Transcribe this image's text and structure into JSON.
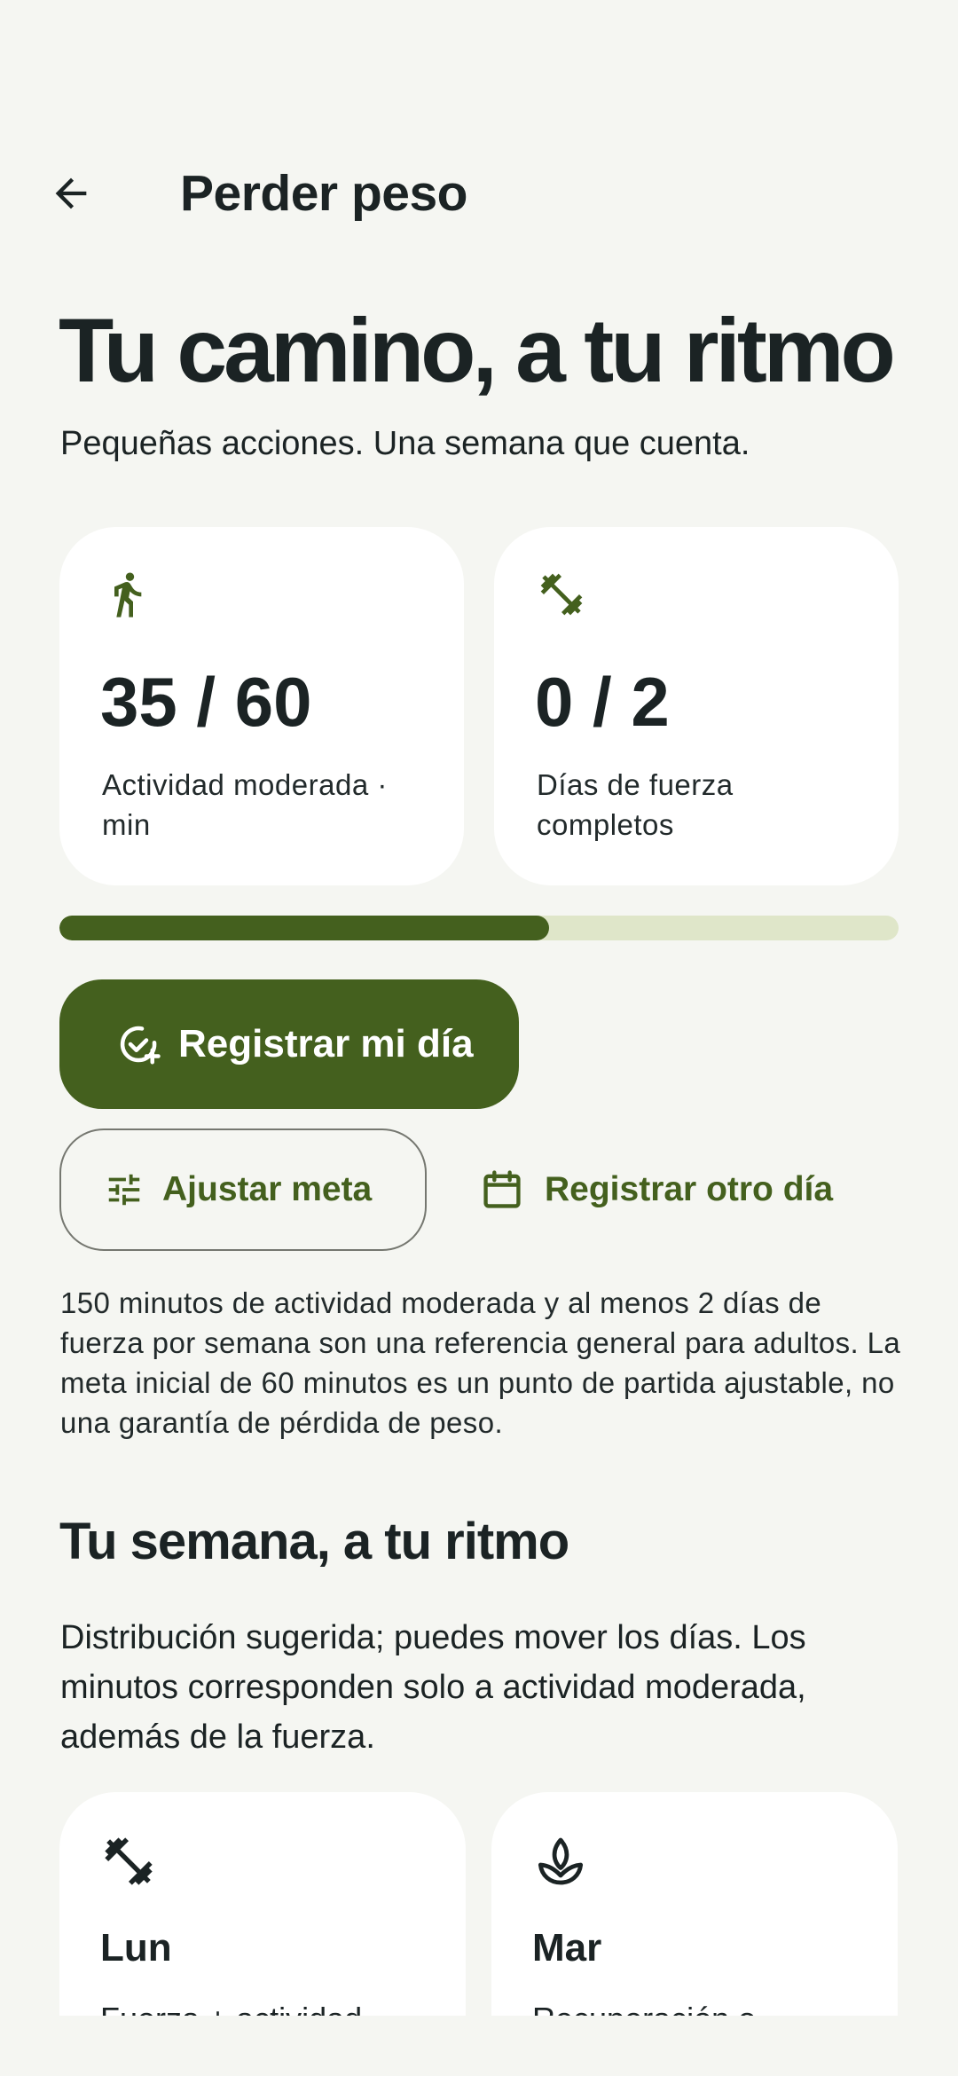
{
  "header": {
    "title": "Perder peso"
  },
  "hero": {
    "title": "Tu camino, a tu ritmo",
    "subtitle": "Pequeñas acciones. Una semana que cuenta."
  },
  "stats": [
    {
      "icon": "walking-person-icon",
      "value": "35 / 60",
      "label": "Actividad moderada · min"
    },
    {
      "icon": "dumbbell-icon",
      "value": "0 / 2",
      "label": "Días de fuerza completos"
    }
  ],
  "progress": {
    "fraction": 0.583
  },
  "actions": {
    "primary_label": "Registrar mi día",
    "adjust_label": "Ajustar meta",
    "other_day_label": "Registrar otro día"
  },
  "note": "150 minutos de actividad moderada y al menos 2 días de fuerza por semana son una referencia general para adultos. La meta inicial de 60 minutos es un punto de partida ajustable, no una garantía de pérdida de peso.",
  "week": {
    "title": "Tu semana, a tu ritmo",
    "description": "Distribución sugerida; puedes mover los días. Los minutos corresponden solo a actividad moderada, además de la fuerza.",
    "days": [
      {
        "icon": "dumbbell-icon",
        "name": "Lun",
        "desc": "Fuerza + actividad"
      },
      {
        "icon": "lotus-icon",
        "name": "Mar",
        "desc": "Recuperación o"
      }
    ]
  },
  "colors": {
    "background": "#f5f6f2",
    "primary": "#44601e",
    "track": "#dfe6c9",
    "text": "#1b2324",
    "card": "#ffffff"
  }
}
